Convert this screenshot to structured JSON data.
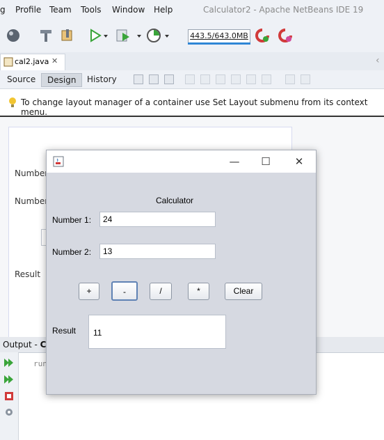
{
  "menubar": {
    "items": [
      "g",
      "Profile",
      "Team",
      "Tools",
      "Window",
      "Help"
    ],
    "title": "Calculator2 - Apache NetBeans IDE 19"
  },
  "toolbar": {
    "memory": "443.5/643.0MB",
    "icons": [
      "globe-icon",
      "hammer-icon",
      "clean-build-icon",
      "run-icon",
      "debug-icon",
      "profile-icon",
      "gc-icon",
      "gc-profile-icon"
    ]
  },
  "editor": {
    "tab_label": "cal2.java",
    "close_glyph": "✕",
    "scroll_glyph": "‹"
  },
  "designbar": {
    "source_label": "Source",
    "design_label": "Design",
    "history_label": "History"
  },
  "hint": {
    "text": "To change layout manager of a container use Set Layout submenu from its context menu."
  },
  "form_designer": {
    "label_number1": "Number",
    "label_number2": "Number",
    "label_result": "Result"
  },
  "output": {
    "title_prefix": "Output - ",
    "title_cut": "Cal",
    "line": "run"
  },
  "calculator": {
    "title": "Calculator",
    "minimize_glyph": "—",
    "maximize_glyph": "☐",
    "close_glyph": "✕",
    "number1_label": "Number 1:",
    "number1_value": "24",
    "number2_label": "Number 2:",
    "number2_value": "13",
    "buttons": [
      "+",
      "-",
      "/",
      "*",
      "Clear"
    ],
    "result_label": "Result",
    "result_value": "11"
  },
  "colors": {
    "accent": "#2f86d6",
    "window_bg": "#d6d9e1"
  }
}
